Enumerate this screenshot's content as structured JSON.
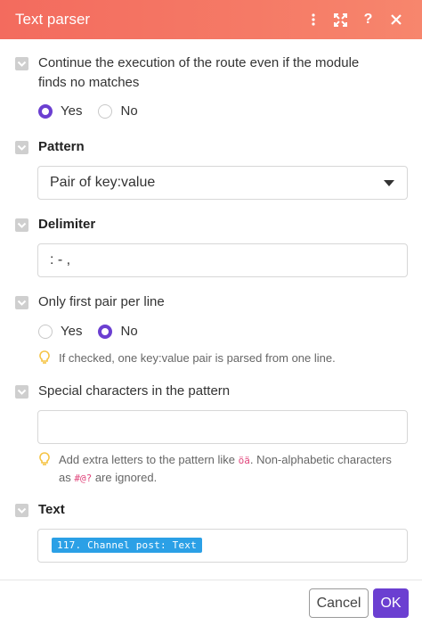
{
  "header": {
    "title": "Text parser",
    "icons": [
      "more-vertical-icon",
      "expand-icon",
      "help-icon",
      "close-icon"
    ],
    "gradient_colors": [
      "#f36b5e",
      "#f7866d"
    ]
  },
  "continue_section": {
    "label_line1": "Continue the execution of the route even if the module",
    "label_line2": "finds no matches",
    "options": [
      "Yes",
      "No"
    ],
    "selected": "Yes"
  },
  "pattern": {
    "label": "Pattern",
    "value": "Pair of key:value"
  },
  "delimiter": {
    "label": "Delimiter",
    "value": ": - ,"
  },
  "first_pair": {
    "label": "Only first pair per line",
    "options": [
      "Yes",
      "No"
    ],
    "selected": "No",
    "hint": "If checked, one key:value pair is parsed from one line."
  },
  "special_chars": {
    "label": "Special characters in the pattern",
    "value": "",
    "hint_part1": "Add extra letters to the pattern like ",
    "hint_code1": "öä",
    "hint_part2": ". Non-alphabetic characters",
    "hint_part3": "as ",
    "hint_code2": "#@?",
    "hint_part4": " are ignored."
  },
  "text": {
    "label": "Text",
    "pill": "117. Channel post: Text"
  },
  "footer": {
    "cancel_label": "Cancel",
    "ok_label": "OK"
  },
  "colors": {
    "accent": "#6b3fd1",
    "pill": "#2ba0e6",
    "hint_bulb": "#f5c342"
  }
}
